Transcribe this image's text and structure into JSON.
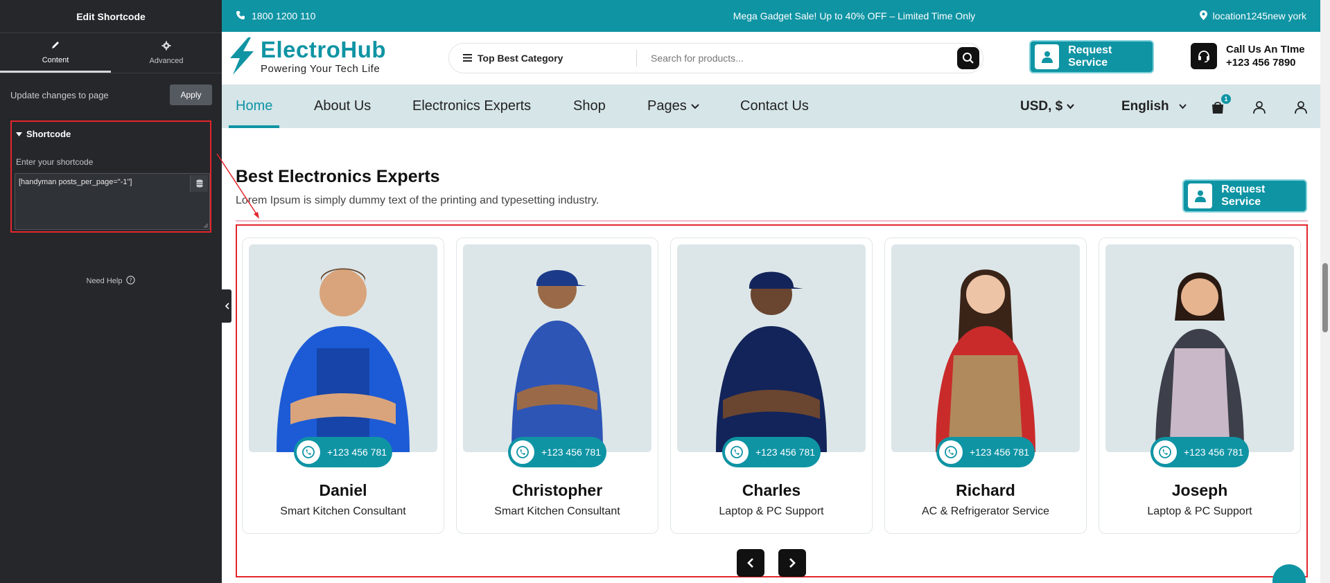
{
  "editor": {
    "title": "Edit Shortcode",
    "tabs": [
      {
        "label": "Content",
        "icon": "pencil-icon"
      },
      {
        "label": "Advanced",
        "icon": "gear-icon"
      }
    ],
    "update_text": "Update changes to page",
    "apply_label": "Apply",
    "section_title": "Shortcode",
    "field_label": "Enter your shortcode",
    "shortcode_value": "[handyman posts_per_page=\"-1\"]",
    "need_help": "Need Help"
  },
  "topbar": {
    "phone": "1800 1200 110",
    "promo": "Mega Gadget Sale! Up to 40% OFF – Limited Time Only",
    "location": "location1245new york"
  },
  "header": {
    "brand": "ElectroHub",
    "tagline": "Powering Your Tech Life",
    "category_label": "Top Best Category",
    "search_placeholder": "Search for products...",
    "request_label": "Request Service",
    "call_title": "Call Us An TIme",
    "call_number": "+123 456 7890"
  },
  "nav": {
    "items": [
      "Home",
      "About Us",
      "Electronics Experts",
      "Shop",
      "Pages",
      "Contact Us"
    ],
    "currency": "USD, $",
    "language": "English",
    "cart_count": "1"
  },
  "section": {
    "title": "Best Electronics Experts",
    "subtitle": "Lorem Ipsum is simply dummy text of the printing and typesetting industry.",
    "request_label": "Request Service"
  },
  "experts": [
    {
      "name": "Daniel",
      "role": "Smart Kitchen Consultant",
      "phone": "+123 456 781"
    },
    {
      "name": "Christopher",
      "role": "Smart Kitchen Consultant",
      "phone": "+123 456 781"
    },
    {
      "name": "Charles",
      "role": "Laptop & PC Support",
      "phone": "+123 456 781"
    },
    {
      "name": "Richard",
      "role": "AC & Refrigerator Service",
      "phone": "+123 456 781"
    },
    {
      "name": "Joseph",
      "role": "Laptop & PC Support",
      "phone": "+123 456 781"
    }
  ],
  "colors": {
    "accent": "#0f94a4",
    "panel": "#25272b",
    "highlight": "#e3262c"
  }
}
